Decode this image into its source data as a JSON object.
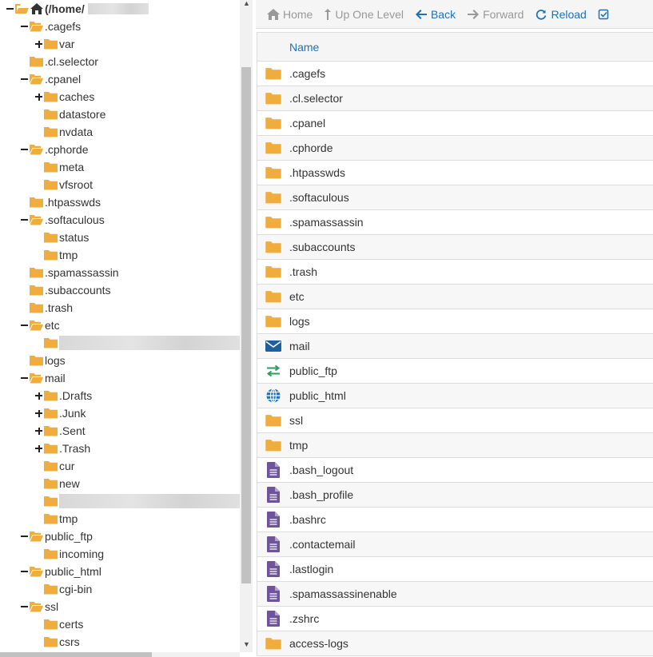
{
  "tree": {
    "root_label": "(/home/",
    "nodes": [
      {
        "label": ".cagefs",
        "depth": 1,
        "toggle": "minus",
        "open": true
      },
      {
        "label": "var",
        "depth": 2,
        "toggle": "plus",
        "open": false
      },
      {
        "label": ".cl.selector",
        "depth": 1,
        "toggle": "none",
        "open": false
      },
      {
        "label": ".cpanel",
        "depth": 1,
        "toggle": "minus",
        "open": true
      },
      {
        "label": "caches",
        "depth": 2,
        "toggle": "plus",
        "open": false
      },
      {
        "label": "datastore",
        "depth": 2,
        "toggle": "none",
        "open": false
      },
      {
        "label": "nvdata",
        "depth": 2,
        "toggle": "none",
        "open": false
      },
      {
        "label": ".cphorde",
        "depth": 1,
        "toggle": "minus",
        "open": true
      },
      {
        "label": "meta",
        "depth": 2,
        "toggle": "none",
        "open": false
      },
      {
        "label": "vfsroot",
        "depth": 2,
        "toggle": "none",
        "open": false
      },
      {
        "label": ".htpasswds",
        "depth": 1,
        "toggle": "none",
        "open": false
      },
      {
        "label": ".softaculous",
        "depth": 1,
        "toggle": "minus",
        "open": true
      },
      {
        "label": "status",
        "depth": 2,
        "toggle": "none",
        "open": false
      },
      {
        "label": "tmp",
        "depth": 2,
        "toggle": "none",
        "open": false
      },
      {
        "label": ".spamassassin",
        "depth": 1,
        "toggle": "none",
        "open": false
      },
      {
        "label": ".subaccounts",
        "depth": 1,
        "toggle": "none",
        "open": false
      },
      {
        "label": ".trash",
        "depth": 1,
        "toggle": "none",
        "open": false
      },
      {
        "label": "etc",
        "depth": 1,
        "toggle": "minus",
        "open": true
      },
      {
        "label": "",
        "depth": 2,
        "toggle": "none",
        "open": false,
        "redacted": true
      },
      {
        "label": "logs",
        "depth": 1,
        "toggle": "none",
        "open": false
      },
      {
        "label": "mail",
        "depth": 1,
        "toggle": "minus",
        "open": true
      },
      {
        "label": ".Drafts",
        "depth": 2,
        "toggle": "plus",
        "open": false
      },
      {
        "label": ".Junk",
        "depth": 2,
        "toggle": "plus",
        "open": false
      },
      {
        "label": ".Sent",
        "depth": 2,
        "toggle": "plus",
        "open": false
      },
      {
        "label": ".Trash",
        "depth": 2,
        "toggle": "plus",
        "open": false
      },
      {
        "label": "cur",
        "depth": 2,
        "toggle": "none",
        "open": false
      },
      {
        "label": "new",
        "depth": 2,
        "toggle": "none",
        "open": false
      },
      {
        "label": "",
        "depth": 2,
        "toggle": "none",
        "open": false,
        "redacted": true
      },
      {
        "label": "tmp",
        "depth": 2,
        "toggle": "none",
        "open": false
      },
      {
        "label": "public_ftp",
        "depth": 1,
        "toggle": "minus",
        "open": true
      },
      {
        "label": "incoming",
        "depth": 2,
        "toggle": "none",
        "open": false
      },
      {
        "label": "public_html",
        "depth": 1,
        "toggle": "minus",
        "open": true
      },
      {
        "label": "cgi-bin",
        "depth": 2,
        "toggle": "none",
        "open": false
      },
      {
        "label": "ssl",
        "depth": 1,
        "toggle": "minus",
        "open": true
      },
      {
        "label": "certs",
        "depth": 2,
        "toggle": "none",
        "open": false
      },
      {
        "label": "csrs",
        "depth": 2,
        "toggle": "none",
        "open": false
      }
    ]
  },
  "toolbar": {
    "home": "Home",
    "up": "Up One Level",
    "back": "Back",
    "forward": "Forward",
    "reload": "Reload"
  },
  "table": {
    "header_name": "Name",
    "rows": [
      {
        "name": ".cagefs",
        "icon": "folder"
      },
      {
        "name": ".cl.selector",
        "icon": "folder"
      },
      {
        "name": ".cpanel",
        "icon": "folder"
      },
      {
        "name": ".cphorde",
        "icon": "folder"
      },
      {
        "name": ".htpasswds",
        "icon": "folder"
      },
      {
        "name": ".softaculous",
        "icon": "folder"
      },
      {
        "name": ".spamassassin",
        "icon": "folder"
      },
      {
        "name": ".subaccounts",
        "icon": "folder"
      },
      {
        "name": ".trash",
        "icon": "folder"
      },
      {
        "name": "etc",
        "icon": "folder"
      },
      {
        "name": "logs",
        "icon": "folder"
      },
      {
        "name": "mail",
        "icon": "mail"
      },
      {
        "name": "public_ftp",
        "icon": "ftp"
      },
      {
        "name": "public_html",
        "icon": "globe"
      },
      {
        "name": "ssl",
        "icon": "folder"
      },
      {
        "name": "tmp",
        "icon": "folder"
      },
      {
        "name": ".bash_logout",
        "icon": "file"
      },
      {
        "name": ".bash_profile",
        "icon": "file"
      },
      {
        "name": ".bashrc",
        "icon": "file"
      },
      {
        "name": ".contactemail",
        "icon": "file"
      },
      {
        "name": ".lastlogin",
        "icon": "file"
      },
      {
        "name": ".spamassassinenable",
        "icon": "file"
      },
      {
        "name": ".zshrc",
        "icon": "file"
      },
      {
        "name": "access-logs",
        "icon": "folder"
      }
    ]
  },
  "colors": {
    "folder": "#f0ad3e",
    "accent": "#1d72b8",
    "file": "#6f5499",
    "ftp": "#2e9e5b",
    "mail": "#1f5fa0"
  }
}
